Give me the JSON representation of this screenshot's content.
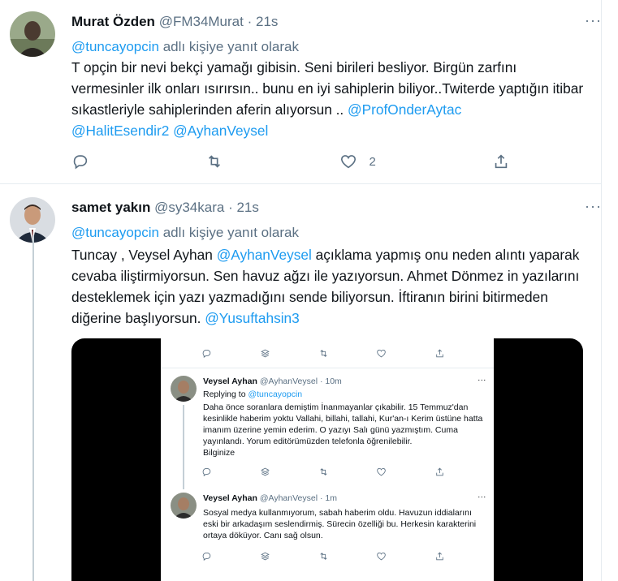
{
  "tweet1": {
    "name": "Murat Özden",
    "handle": "@FM34Murat",
    "dot": "·",
    "time": "21s",
    "more": "···",
    "replying_handle": "@tuncayopcin",
    "replying_suffix": " adlı kişiye yanıt olarak",
    "text": "T opçin  bir nevi bekçi yamağı gibisin. Seni birileri besliyor. Birgün zarfını vermesinler ilk onları ısırırsın.. bunu en iyi sahiplerin biliyor..Twiterde yaptığın itibar sıkastleriyle sahiplerinden aferin alıyorsun .. ",
    "mention1": "@ProfOnderAytac",
    "mention2": "@HalitEsendir2",
    "mention3": "@AyhanVeysel",
    "like_count": "2"
  },
  "tweet2": {
    "name": "samet yakın",
    "handle": "@sy34kara",
    "dot": "·",
    "time": "21s",
    "more": "···",
    "replying_handle": "@tuncayopcin",
    "replying_suffix": " adlı kişiye yanıt olarak",
    "text_a": "Tuncay , Veysel Ayhan ",
    "mention_a": "@AyhanVeysel",
    "text_b": " açıklama yapmış onu neden alıntı yaparak cevaba iliştirmiyorsun. Sen havuz ağzı ile yazıyorsun.  Ahmet Dönmez in yazılarını desteklemek için yazı yazmadığını sende biliyorsun. İftiranın birini bitirmeden diğerine başlıyorsun. ",
    "mention_b": "@Yusuftahsin3"
  },
  "embedded": {
    "t1": {
      "name": "Veysel Ayhan",
      "handle": "@AyhanVeysel",
      "time": "· 10m",
      "more": "···",
      "replying_prefix": "Replying to ",
      "replying_handle": "@tuncayopcin",
      "text": "Daha önce soranlara demiştim İnanmayanlar çıkabilir. 15 Temmuz'dan kesinlikle haberim yoktu Vallahi, billahi, tallahi, Kur'an-ı Kerim üstüne hatta imanım üzerine yemin ederim. O yazıyı Salı günü yazmıştım. Cuma yayınlandı. Yorum editörümüzden telefonla öğrenilebilir.",
      "text2": "Bilginize"
    },
    "t2": {
      "name": "Veysel Ayhan",
      "handle": "@AyhanVeysel",
      "time": "· 1m",
      "more": "···",
      "text": "Sosyal medya kullanmıyorum, sabah haberim oldu. Havuzun iddialarını eski bir arkadaşım seslendirmiş. Sürecin özelliği bu. Herkesin karakterini ortaya döküyor. Canı sağ olsun."
    }
  },
  "icons": [
    "comment-icon",
    "retweet-icon",
    "like-icon",
    "share-icon",
    "more-icon",
    "layers-icon"
  ],
  "colors": {
    "link": "#1d9bf0",
    "muted": "#5b7083",
    "text": "#0f1419",
    "divider": "#e6ecf0"
  }
}
